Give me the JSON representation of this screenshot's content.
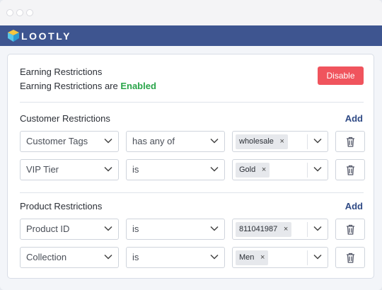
{
  "brand": {
    "name": "LOOTLY",
    "bar_color": "#3e5590"
  },
  "earning": {
    "title": "Earning Restrictions",
    "status_prefix": "Earning Restrictions are ",
    "status_value": "Enabled",
    "disable_label": "Disable"
  },
  "customer": {
    "title": "Customer Restrictions",
    "add_label": "Add",
    "rows": [
      {
        "field": "Customer Tags",
        "operator": "has any of",
        "tag": "wholesale"
      },
      {
        "field": "VIP Tier",
        "operator": "is",
        "tag": "Gold"
      }
    ]
  },
  "product": {
    "title": "Product Restrictions",
    "add_label": "Add",
    "rows": [
      {
        "field": "Product ID",
        "operator": "is",
        "tag": "811041987"
      },
      {
        "field": "Collection",
        "operator": "is",
        "tag": "Men"
      }
    ]
  },
  "icons": {
    "remove_tag": "×",
    "dropdown": "chevron-down-icon",
    "delete": "trash-icon"
  },
  "colors": {
    "enabled": "#2aa54a",
    "disable_button": "#f0545d",
    "add_link": "#2f4a85"
  }
}
